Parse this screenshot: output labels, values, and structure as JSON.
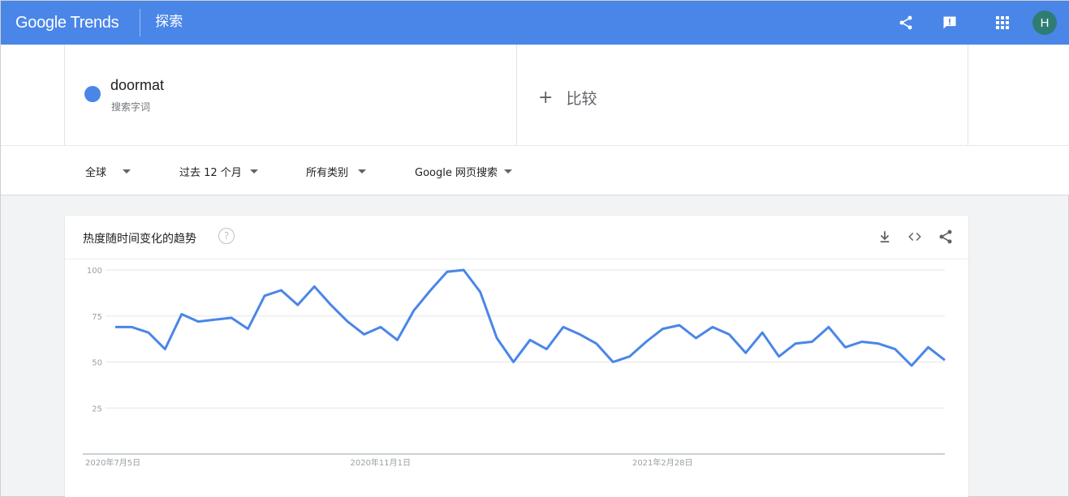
{
  "header": {
    "logo": "Google Trends",
    "explore_label": "探索",
    "icons": [
      "share-icon",
      "feedback-icon",
      "apps-icon"
    ],
    "avatar_letter": "H",
    "bar_color": "#4a86e8"
  },
  "terms": {
    "term1": {
      "name": "doormat",
      "subtitle": "搜索字词",
      "color": "#4a86e8"
    },
    "compare_label": "比较"
  },
  "filters": {
    "region": "全球",
    "time": "过去 12 个月",
    "category": "所有类别",
    "search_type": "Google 网页搜索"
  },
  "card": {
    "title": "热度随时间变化的趋势",
    "help": "?",
    "icons": [
      "download-icon",
      "embed-icon",
      "share-icon"
    ]
  },
  "chart_data": {
    "type": "line",
    "title": "热度随时间变化的趋势",
    "xlabel": "",
    "ylabel": "",
    "ylim": [
      0,
      100
    ],
    "yticks": [
      25,
      50,
      75,
      100
    ],
    "grid": true,
    "x_tick_labels": [
      {
        "index": 0,
        "label": "2020年7月5日"
      },
      {
        "index": 17,
        "label": "2020年11月1日"
      },
      {
        "index": 34,
        "label": "2021年2月28日"
      }
    ],
    "series": [
      {
        "color": "#4a86e8",
        "values": [
          69,
          69,
          66,
          57,
          76,
          72,
          73,
          74,
          68,
          86,
          89,
          81,
          91,
          81,
          72,
          65,
          69,
          62,
          78,
          89,
          99,
          100,
          88,
          63,
          50,
          62,
          57,
          69,
          65,
          60,
          50,
          53,
          61,
          68,
          70,
          63,
          69,
          65,
          55,
          66,
          53,
          60,
          61,
          69,
          58,
          61,
          60,
          57,
          48,
          58,
          51
        ]
      }
    ]
  }
}
